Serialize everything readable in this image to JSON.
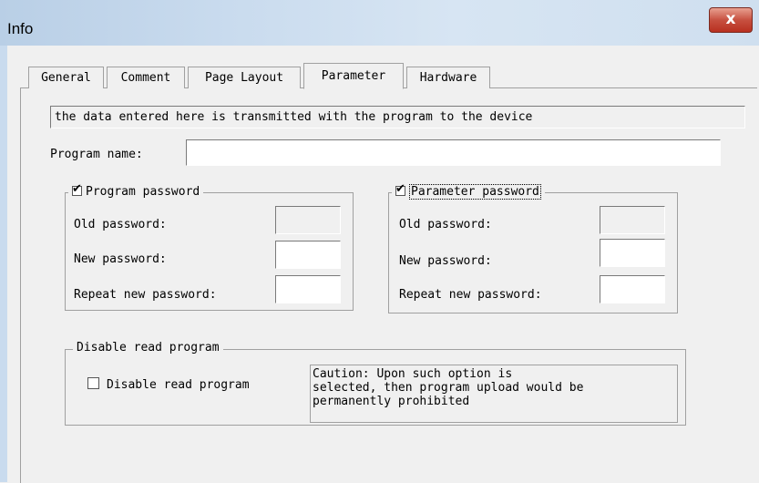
{
  "window": {
    "title": "Info",
    "close_glyph": "x"
  },
  "tabs": [
    {
      "label": "General"
    },
    {
      "label": "Comment"
    },
    {
      "label": "Page Layout"
    },
    {
      "label": "Parameter",
      "active": true
    },
    {
      "label": "Hardware"
    }
  ],
  "info_text": "the data entered here is transmitted  with the  program  to the device",
  "program_name": {
    "label": "Program name:",
    "value": ""
  },
  "program_password": {
    "legend": "Program password",
    "checked": true,
    "old_label": "Old password:",
    "new_label": "New password:",
    "repeat_label": "Repeat new password:"
  },
  "parameter_password": {
    "legend": "Parameter password",
    "checked": true,
    "old_label": "Old password:",
    "new_label": "New password:",
    "repeat_label": "Repeat new password:"
  },
  "disable_read": {
    "legend": "Disable read program",
    "checkbox_label": "Disable read program",
    "checked": false,
    "caution_lines": [
      "Caution: Upon such option is",
      "selected, then program upload would be",
      "permanently prohibited"
    ]
  },
  "check_glyph": "✔"
}
